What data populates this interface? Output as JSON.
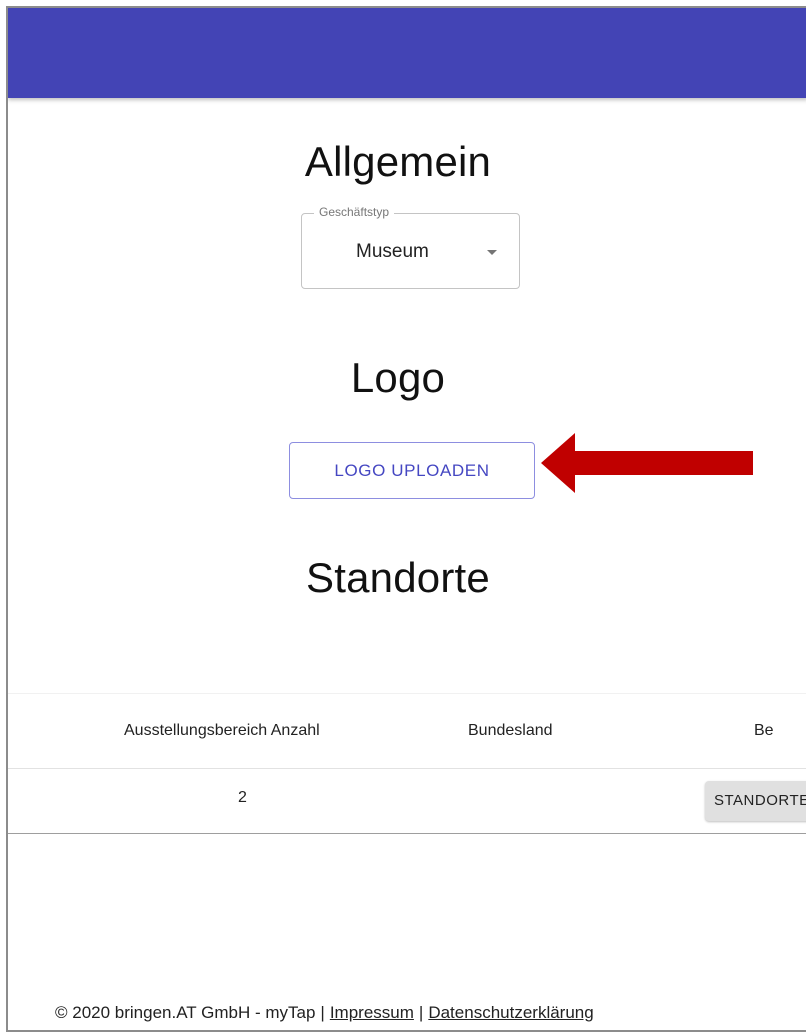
{
  "sections": {
    "general_title": "Allgemein",
    "logo_title": "Logo",
    "locations_title": "Standorte"
  },
  "business_type": {
    "label": "Geschäftstyp",
    "value": "Museum"
  },
  "logo": {
    "upload_label": "LOGO UPLOADEN"
  },
  "table": {
    "headers": [
      "Ausstellungsbereich Anzahl",
      "Bundesland",
      "Be"
    ],
    "rows": [
      {
        "count": "2",
        "action_label": "STANDORTE"
      }
    ]
  },
  "footer": {
    "copyright": "© 2020 bringen.AT GmbH - myTap",
    "separator": "|",
    "impressum": "Impressum",
    "privacy": "Datenschutzerklärung"
  },
  "colors": {
    "appbar": "#4344b5",
    "primary": "#4547c2",
    "annotation_arrow": "#c00000"
  }
}
